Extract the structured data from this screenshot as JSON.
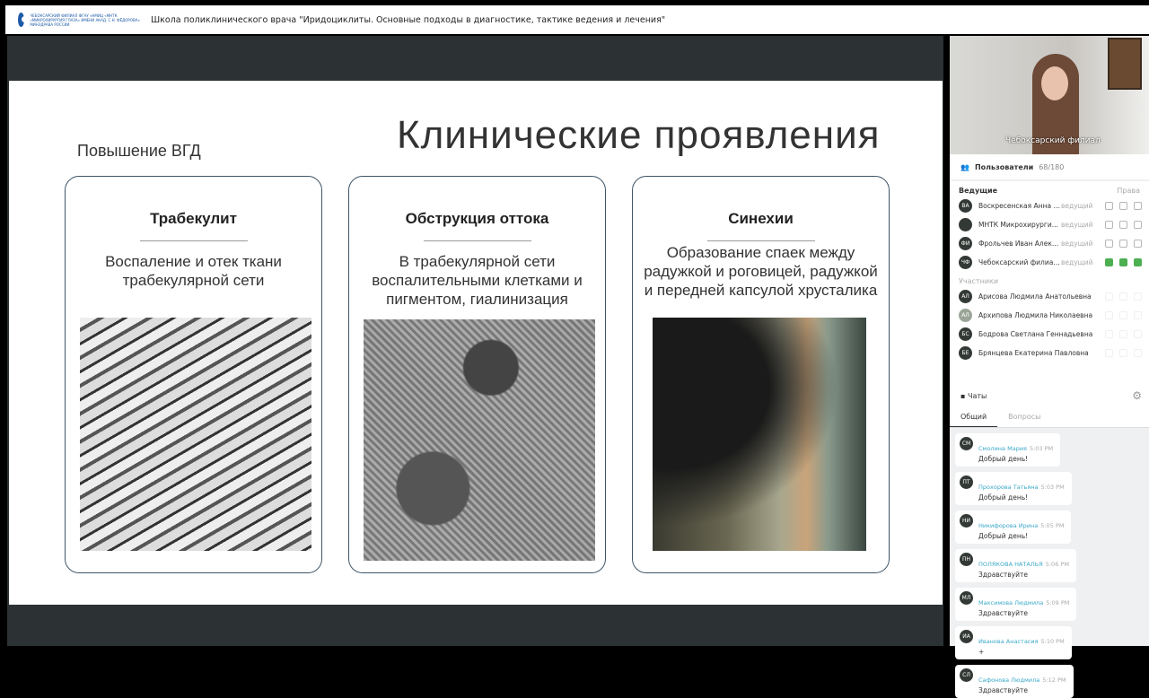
{
  "header": {
    "logo_text": "ЧЕБОКСАРСКИЙ ФИЛИАЛ ФГАУ «НМИЦ «МНТК «МИКРОХИРУРГИЯ ГЛАЗА» ИМЕНИ АКАД. С.Н. ФЁДОРОВА» МИНЗДРАВА РОССИИ",
    "title": "Школа поликлинического врача \"Иридоциклиты. Основные подходы в диагностике, тактике ведения и лечения\""
  },
  "slide": {
    "title": "Клинические проявления",
    "subtitle": "Повышение ВГД",
    "cards": [
      {
        "heading": "Трабекулит",
        "text": "Воспаление и отек ткани трабекулярной сети"
      },
      {
        "heading": "Обструкция оттока",
        "text": "В трабекулярной сети воспалительными клетками и пигментом, гиалинизация"
      },
      {
        "heading": "Синехии",
        "text": "Образование спаек между радужкой и роговицей, радужкой и передней капсулой хрусталика"
      }
    ]
  },
  "video": {
    "caption": "Чебоксарский филиал"
  },
  "users": {
    "label": "Пользователи",
    "count": "68/180",
    "hosts_label": "Ведущие",
    "rights_label": "Права",
    "hosts": [
      {
        "initials": "ВА",
        "name": "Воскресенская Анна А...",
        "role": "ведущий"
      },
      {
        "initials": "",
        "name": "МНТК Микрохирурги...",
        "role": "ведущий"
      },
      {
        "initials": "ФИ",
        "name": "Фрольчев Иван Алекс...",
        "role": "ведущий"
      },
      {
        "initials": "ЧФ",
        "name": "Чебоксарский филиал...",
        "role": "ведущий"
      }
    ],
    "participants_label": "Участники",
    "participants": [
      {
        "initials": "АЛ",
        "name": "Арисова Людмила Анатольевна"
      },
      {
        "initials": "АЛ",
        "name": "Архипова Людмила Николаевна"
      },
      {
        "initials": "БС",
        "name": "Бодрова Светлана Геннадьевна"
      },
      {
        "initials": "БЕ",
        "name": "Брянцева Екатерина Павловна"
      }
    ]
  },
  "chats": {
    "label": "Чаты",
    "tabs": [
      "Общий",
      "Вопросы"
    ],
    "messages": [
      {
        "initials": "СМ",
        "name": "Смолина Мария",
        "time": "5:03 PM",
        "text": "Добрый день!"
      },
      {
        "initials": "ПТ",
        "name": "Прохорова Татьяна",
        "time": "5:03 PM",
        "text": "Добрый день!"
      },
      {
        "initials": "НИ",
        "name": "Никифорова Ирина",
        "time": "5:05 PM",
        "text": "Добрый день!"
      },
      {
        "initials": "ПН",
        "name": "ПОЛЯКОВА НАТАЛЬЯ",
        "time": "5:06 PM",
        "text": "Здравствуйте"
      },
      {
        "initials": "МЛ",
        "name": "Максимова Людмила",
        "time": "5:09 PM",
        "text": "Здравствуйте"
      },
      {
        "initials": "ИА",
        "name": "Иванова Анастасия",
        "time": "5:10 PM",
        "text": "+"
      },
      {
        "initials": "СЛ",
        "name": "Сафонова Людмила",
        "time": "5:12 PM",
        "text": "Здравствуйте"
      }
    ]
  }
}
